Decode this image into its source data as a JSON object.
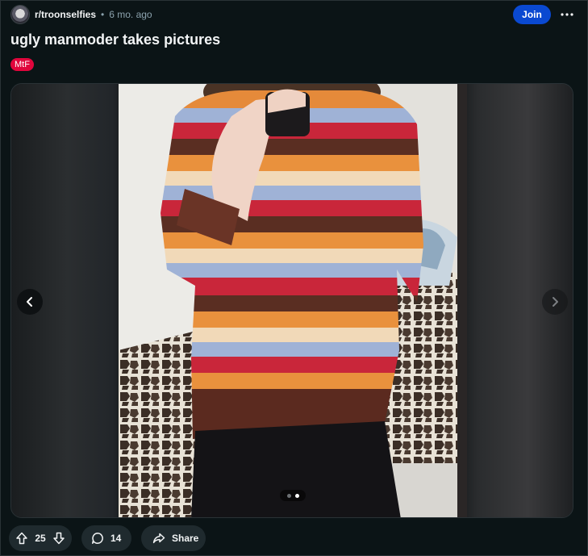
{
  "post": {
    "subreddit": "r/troonselfies",
    "separator": "•",
    "age": "6 mo. ago",
    "title": "ugly manmoder takes pictures",
    "flair": "MtF",
    "join_label": "Join",
    "more_label": "•••"
  },
  "gallery": {
    "total_images": 2,
    "current_index": 2
  },
  "actions": {
    "upvotes": "25",
    "comments": "14",
    "share_label": "Share"
  },
  "colors": {
    "background": "#0b1416",
    "join_button": "#0a49d1",
    "flair": "#e0063c",
    "pill": "#1f2a2e",
    "text_muted": "#8ba2ad"
  },
  "icons": {
    "avatar": "subreddit-avatar",
    "more": "ellipsis-icon",
    "prev": "chevron-left-icon",
    "next": "chevron-right-icon",
    "upvote": "upvote-arrow-icon",
    "downvote": "downvote-arrow-icon",
    "comment": "comment-bubble-icon",
    "share": "share-arrow-icon"
  }
}
